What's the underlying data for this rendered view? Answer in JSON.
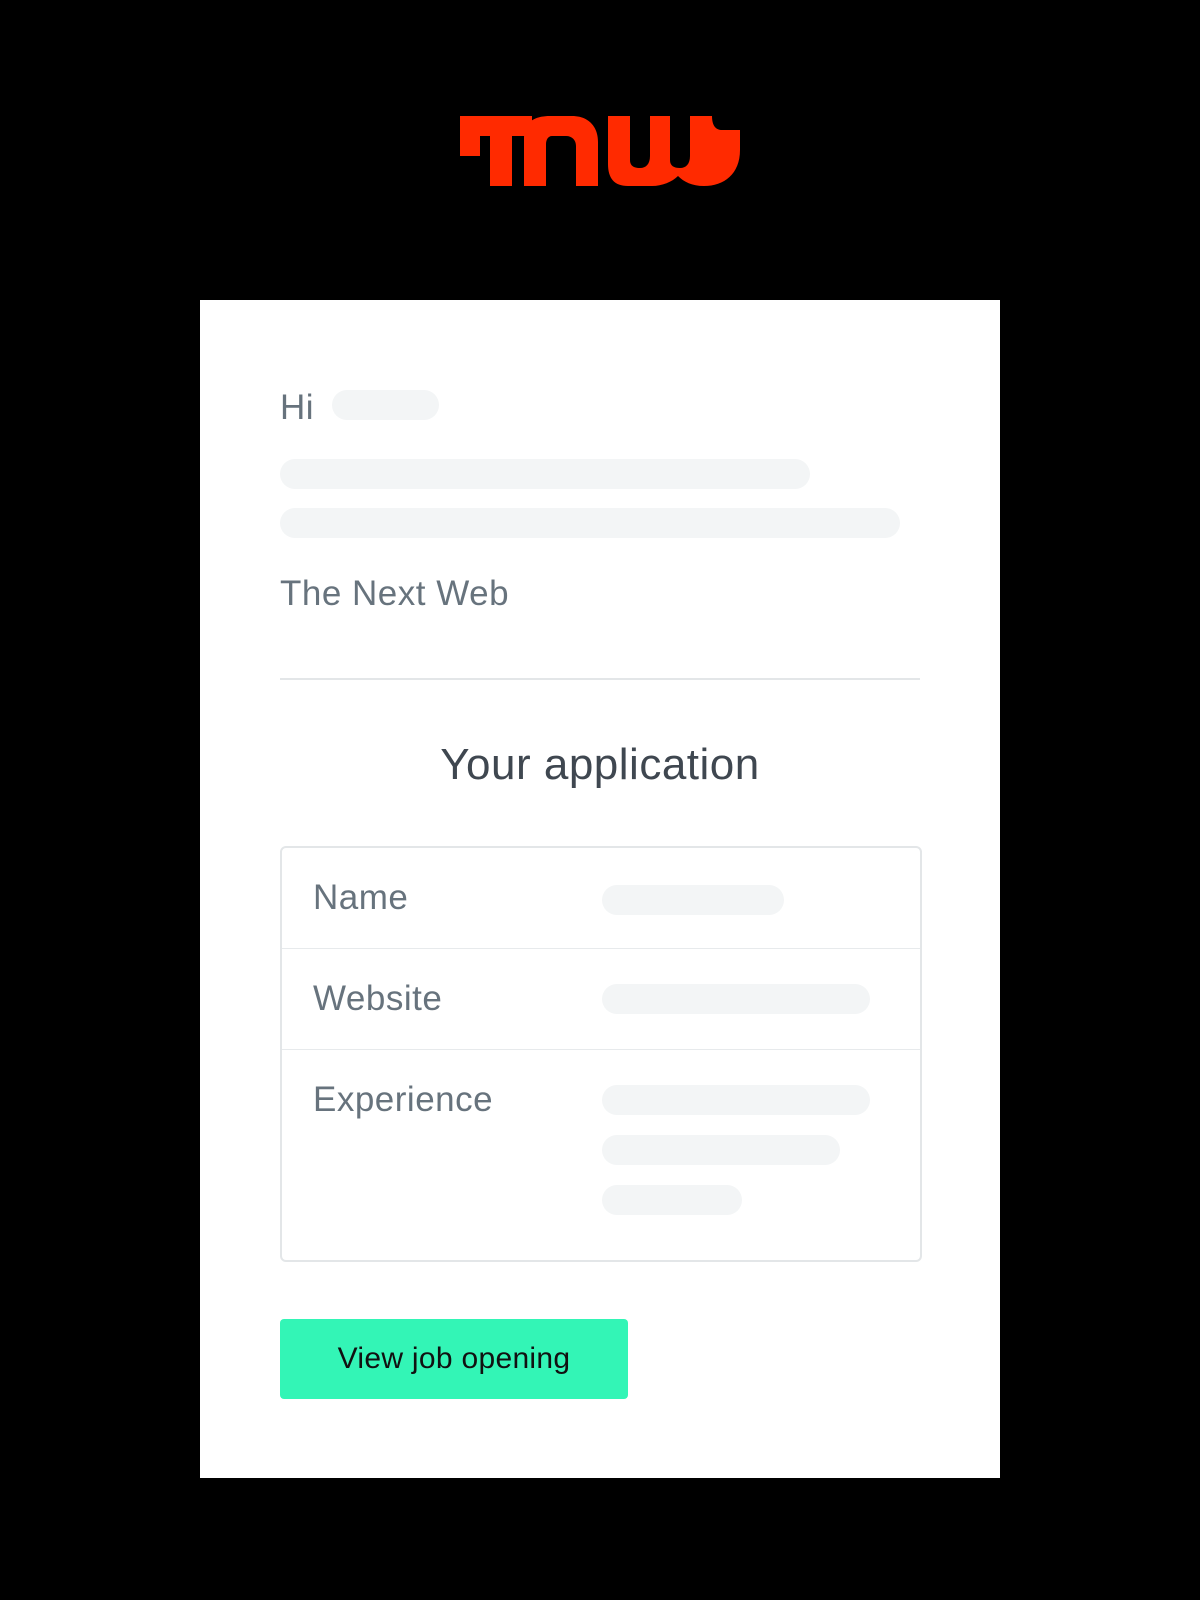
{
  "brand": {
    "logo_text": "TNW",
    "logo_color": "#ff2a00"
  },
  "email": {
    "greeting": "Hi",
    "signoff": "The Next Web",
    "section_title": "Your application",
    "fields": [
      {
        "label": "Name"
      },
      {
        "label": "Website"
      },
      {
        "label": "Experience"
      }
    ],
    "cta_label": "View job opening"
  },
  "colors": {
    "background": "#000000",
    "card": "#ffffff",
    "placeholder": "#f3f5f6",
    "cta": "#33f5b6",
    "label_text": "#67737d",
    "title_text": "#3f4750"
  }
}
